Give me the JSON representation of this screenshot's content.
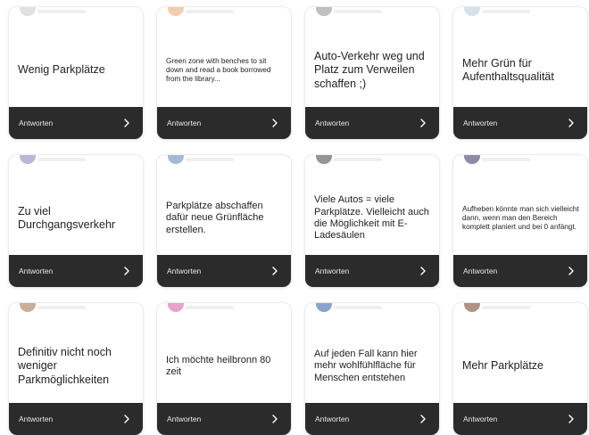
{
  "colors": {
    "footer_bg": "#2b2b2b",
    "card_bg": "#ffffff",
    "text": "#222222"
  },
  "reply_label": "Antworten",
  "cards": [
    {
      "text": "Wenig Parkplätze",
      "size": "lg",
      "avatar_color": "#c9c9c9"
    },
    {
      "text": "Green zone with benches to sit down and read a book borrowed from the library...",
      "size": "sm",
      "avatar_color": "#e8a66a"
    },
    {
      "text": "Auto-Verkehr weg und Platz zum Verweilen schaffen ;)",
      "size": "lg",
      "avatar_color": "#8a8a8a"
    },
    {
      "text": "Mehr Grün für Aufenthaltsqualität",
      "size": "lg",
      "avatar_color": "#b8c7d8"
    },
    {
      "text": "Zu viel Durchgangsverkehr",
      "size": "lg",
      "avatar_color": "#7d7fb0"
    },
    {
      "text": "Parkplätze abschaffen dafür neue Grünfläche erstellen.",
      "size": "md",
      "avatar_color": "#5b7fb5"
    },
    {
      "text": "Viele Autos = viele Parkplätze. Vielleicht auch die Möglichkeit mit E-Ladesäulen",
      "size": "md",
      "avatar_color": "#3c3c3c"
    },
    {
      "text": "Aufheben könnte man sich vielleicht dann, wenn man den Bereich komplett planiert und bei 0 anfängt.",
      "size": "sm",
      "avatar_color": "#2e2e5e"
    },
    {
      "text": "Definitiv nicht noch weniger Parkmöglichkeiten",
      "size": "lg",
      "avatar_color": "#9b6b4b"
    },
    {
      "text": "Ich möchte heilbronn 80 zeit",
      "size": "md",
      "avatar_color": "#d25aa0"
    },
    {
      "text": "Auf jeden Fall kann hier mehr wohlfühlfläche für Menschen entstehen",
      "size": "md",
      "avatar_color": "#2a5aa0"
    },
    {
      "text": "Mehr Parkplätze",
      "size": "lg",
      "avatar_color": "#6b3a1f"
    }
  ]
}
